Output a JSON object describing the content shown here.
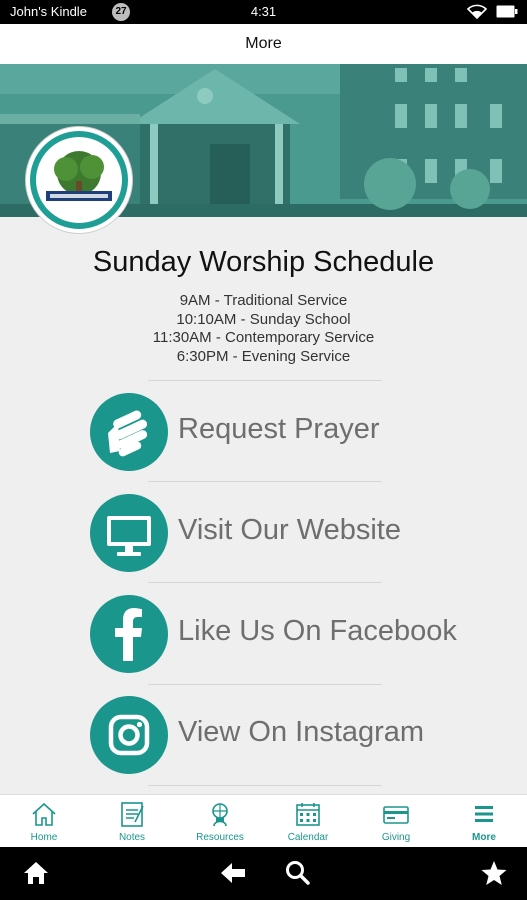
{
  "status": {
    "device_name": "John's Kindle",
    "notification_count": "27",
    "time": "4:31"
  },
  "header": {
    "title": "More"
  },
  "schedule": {
    "title": "Sunday Worship Schedule",
    "lines": [
      "9AM - Traditional Service",
      "10:10AM - Sunday School",
      "11:30AM - Contemporary Service",
      "6:30PM - Evening Service"
    ]
  },
  "actions": [
    {
      "label": "Request Prayer",
      "icon": "praying-hands-icon"
    },
    {
      "label": "Visit Our Website",
      "icon": "monitor-icon"
    },
    {
      "label": "Like Us On Facebook",
      "icon": "facebook-icon"
    },
    {
      "label": "View On Instagram",
      "icon": "instagram-icon"
    }
  ],
  "nav": [
    {
      "label": "Home",
      "icon": "home-icon"
    },
    {
      "label": "Notes",
      "icon": "notes-icon"
    },
    {
      "label": "Resources",
      "icon": "resources-icon"
    },
    {
      "label": "Calendar",
      "icon": "calendar-icon"
    },
    {
      "label": "Giving",
      "icon": "giving-card-icon"
    },
    {
      "label": "More",
      "icon": "menu-icon"
    }
  ],
  "colors": {
    "accent": "#1a968d",
    "hero_tint": "#3f8f86"
  }
}
